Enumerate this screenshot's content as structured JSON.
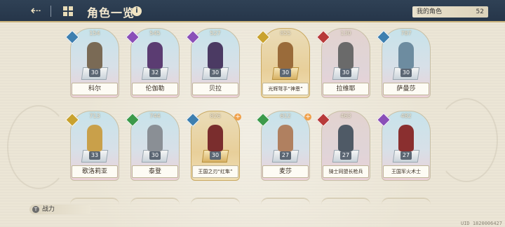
{
  "header": {
    "title": "角色一览",
    "back_icon": "back-arrow-icon",
    "grid_icon": "grid-icon",
    "info_icon": "i",
    "my_roles_label": "我的角色",
    "my_roles_count": "52"
  },
  "characters": [
    {
      "name": "科尔",
      "power": "154",
      "level": "30",
      "class_color": "#3d7fb0",
      "figure_color": "#7a6a55"
    },
    {
      "name": "伦伽勒",
      "power": "545",
      "level": "32",
      "class_color": "#8a4fb8",
      "figure_color": "#5b3c72"
    },
    {
      "name": "贝拉",
      "power": "527",
      "level": "30",
      "class_color": "#8a4fb8",
      "figure_color": "#4b3a63"
    },
    {
      "name": "光辉弩手“神恩”",
      "power": "855",
      "level": "30",
      "class_color": "#c9a22e",
      "figure_color": "#9a6b3a"
    },
    {
      "name": "拉维耶",
      "power": "130",
      "level": "30",
      "class_color": "#b83a3a",
      "figure_color": "#6a6a6a"
    },
    {
      "name": "萨曼莎",
      "power": "787",
      "level": "30",
      "class_color": "#3d7fb0",
      "figure_color": "#6d8ca0"
    },
    {
      "name": "歌洛莉亚",
      "power": "713",
      "level": "33",
      "class_color": "#c9a22e",
      "figure_color": "#c9a04a"
    },
    {
      "name": "泰登",
      "power": "744",
      "level": "30",
      "class_color": "#3c9a4a",
      "figure_color": "#8a8f95"
    },
    {
      "name": "王国之刃“红隼”",
      "power": "826",
      "level": "30",
      "class_color": "#3d7fb0",
      "figure_color": "#7a2d2d"
    },
    {
      "name": "麦莎",
      "power": "612",
      "level": "27",
      "class_color": "#3c9a4a",
      "figure_color": "#b08060"
    },
    {
      "name": "骑士同盟长枪兵",
      "power": "463",
      "level": "27",
      "class_color": "#b83a3a",
      "figure_color": "#4f5a66"
    },
    {
      "name": "王国军火术士",
      "power": "482",
      "level": "27",
      "class_color": "#8a4fb8",
      "figure_color": "#8a2f2f"
    }
  ],
  "footer": {
    "power_sort_label": "战力",
    "sort_icon": "T",
    "uid": "UID 1820006427"
  }
}
